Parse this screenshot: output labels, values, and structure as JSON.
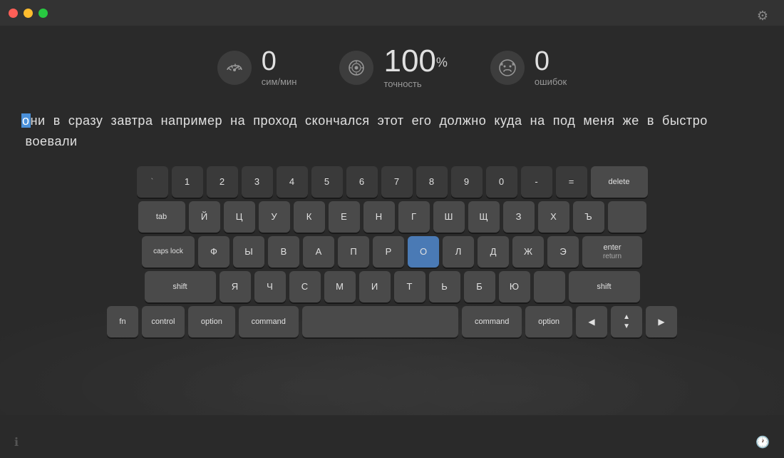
{
  "titlebar": {
    "traffic_lights": [
      "close",
      "minimize",
      "maximize"
    ]
  },
  "settings": {
    "icon": "⚙"
  },
  "stats": {
    "speed": {
      "value": "0",
      "unit": "сим/мин"
    },
    "accuracy": {
      "value": "100",
      "unit": "точность",
      "suffix": "%"
    },
    "errors": {
      "value": "0",
      "unit": "ошибок"
    }
  },
  "typing_text": "они  в  сразу  завтра  например  на  проход  скончался  этот  его  должно  куда  на  под  меня  же  в  быстро  воевали",
  "typing_cursor_char": "о",
  "keyboard": {
    "row1": [
      {
        "label": "`",
        "dark": true
      },
      {
        "label": "1",
        "dark": true
      },
      {
        "label": "2",
        "dark": true
      },
      {
        "label": "3",
        "dark": true
      },
      {
        "label": "4",
        "dark": true
      },
      {
        "label": "5",
        "dark": true
      },
      {
        "label": "6",
        "dark": true
      },
      {
        "label": "7",
        "dark": true
      },
      {
        "label": "8",
        "dark": true
      },
      {
        "label": "9",
        "dark": true
      },
      {
        "label": "0",
        "dark": true
      },
      {
        "label": "-",
        "dark": true
      },
      {
        "label": "=",
        "dark": true
      },
      {
        "label": "delete",
        "wide": true
      }
    ],
    "row2": [
      {
        "label": "tab"
      },
      {
        "label": "Й"
      },
      {
        "label": "Ц"
      },
      {
        "label": "У"
      },
      {
        "label": "К"
      },
      {
        "label": "Е"
      },
      {
        "label": "Н"
      },
      {
        "label": "Г"
      },
      {
        "label": "Ш"
      },
      {
        "label": "Щ"
      },
      {
        "label": "З"
      },
      {
        "label": "Х"
      },
      {
        "label": "Ъ"
      },
      {
        "label": ""
      }
    ],
    "row3": [
      {
        "label": "caps lock"
      },
      {
        "label": "Ф"
      },
      {
        "label": "Ы"
      },
      {
        "label": "В"
      },
      {
        "label": "А"
      },
      {
        "label": "П"
      },
      {
        "label": "Р"
      },
      {
        "label": "О",
        "active": true
      },
      {
        "label": "Л"
      },
      {
        "label": "Д"
      },
      {
        "label": "Ж"
      },
      {
        "label": "Э"
      },
      {
        "label": "enter"
      }
    ],
    "row4": [
      {
        "label": "shift"
      },
      {
        "label": "Я"
      },
      {
        "label": "Ч"
      },
      {
        "label": "С"
      },
      {
        "label": "М"
      },
      {
        "label": "И"
      },
      {
        "label": "Т"
      },
      {
        "label": "Ь"
      },
      {
        "label": "Б"
      },
      {
        "label": "Ю"
      },
      {
        "label": ""
      },
      {
        "label": "shift",
        "right": true
      }
    ],
    "row5": [
      {
        "label": "fn"
      },
      {
        "label": "control"
      },
      {
        "label": "option"
      },
      {
        "label": "command"
      },
      {
        "label": ""
      },
      {
        "label": "command"
      },
      {
        "label": "option"
      },
      {
        "label": "◀"
      },
      {
        "label": "▲▼"
      },
      {
        "label": "▶"
      }
    ]
  },
  "bottom": {
    "left_icon": "ℹ",
    "right_icon": "🕐"
  }
}
